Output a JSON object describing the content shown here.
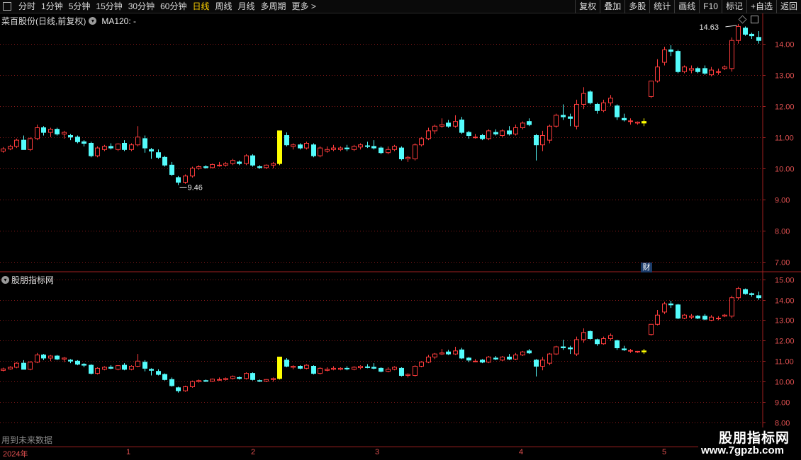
{
  "toolbar": {
    "periods": [
      "分时",
      "1分钟",
      "5分钟",
      "15分钟",
      "30分钟",
      "60分钟",
      "日线",
      "周线",
      "月线",
      "多周期",
      "更多 >"
    ],
    "active_period": "日线",
    "right_buttons": [
      "复权",
      "叠加",
      "多股",
      "统计",
      "画线",
      "F10",
      "标记",
      "+自选",
      "返回"
    ]
  },
  "main_panel": {
    "title": "菜百股份(日线,前复权)",
    "ma_label": "MA120: -",
    "high_label": "14.63",
    "low_label": "9.46",
    "badge": "财",
    "y_ticks": [
      "14.00",
      "13.00",
      "12.00",
      "11.00",
      "10.00",
      "9.00",
      "8.00",
      "7.00"
    ]
  },
  "sub_panel": {
    "title": "股朋指标网",
    "y_ticks": [
      "15.00",
      "14.00",
      "13.00",
      "12.00",
      "11.00",
      "10.00",
      "9.00",
      "8.00"
    ]
  },
  "footnote": "用到未来数据",
  "timeline": {
    "labels": [
      "2024年",
      "1",
      "2",
      "3",
      "4",
      "5"
    ]
  },
  "watermark": {
    "name": "股朋指标网",
    "url": "www.7gpzb.com"
  },
  "colors": {
    "up": "#ff3c3c",
    "down": "#54fcfc",
    "signal": "#ffff00",
    "grid": "#8a1a1a",
    "axis_text": "#e05050"
  },
  "chart_data": {
    "type": "candlestick",
    "ohlc": [
      [
        10.55,
        10.68,
        10.5,
        10.62
      ],
      [
        10.62,
        10.75,
        10.58,
        10.7
      ],
      [
        10.7,
        10.95,
        10.65,
        10.9
      ],
      [
        10.9,
        11.05,
        10.85,
        10.6
      ],
      [
        10.6,
        11.0,
        10.55,
        10.95
      ],
      [
        10.95,
        11.4,
        10.9,
        11.3
      ],
      [
        11.3,
        11.35,
        11.05,
        11.15
      ],
      [
        11.15,
        11.3,
        11.0,
        11.25
      ],
      [
        11.25,
        11.3,
        11.05,
        11.1
      ],
      [
        11.1,
        11.2,
        10.95,
        11.15
      ],
      [
        11.05,
        11.1,
        10.9,
        11.0
      ],
      [
        11.0,
        11.05,
        10.8,
        10.85
      ],
      [
        10.85,
        10.9,
        10.7,
        10.8
      ],
      [
        10.8,
        10.85,
        10.35,
        10.4
      ],
      [
        10.4,
        10.7,
        10.35,
        10.65
      ],
      [
        10.6,
        10.75,
        10.55,
        10.7
      ],
      [
        10.7,
        10.8,
        10.6,
        10.65
      ],
      [
        10.6,
        10.8,
        10.55,
        10.78
      ],
      [
        10.8,
        10.9,
        10.55,
        10.6
      ],
      [
        10.6,
        10.8,
        10.55,
        10.75
      ],
      [
        10.75,
        11.35,
        10.7,
        11.0
      ],
      [
        10.95,
        11.05,
        10.5,
        10.65
      ],
      [
        10.6,
        10.65,
        10.3,
        10.55
      ],
      [
        10.5,
        10.6,
        10.3,
        10.35
      ],
      [
        10.35,
        10.4,
        10.05,
        10.1
      ],
      [
        10.1,
        10.2,
        9.75,
        9.8
      ],
      [
        9.7,
        9.75,
        9.46,
        9.55
      ],
      [
        9.55,
        9.8,
        9.5,
        9.75
      ],
      [
        9.75,
        10.05,
        9.7,
        10.0
      ],
      [
        10.0,
        10.1,
        9.95,
        10.05
      ],
      [
        10.05,
        10.1,
        9.98,
        10.02
      ],
      [
        10.02,
        10.15,
        10.0,
        10.12
      ],
      [
        10.1,
        10.2,
        10.05,
        10.1
      ],
      [
        10.1,
        10.2,
        10.05,
        10.15
      ],
      [
        10.15,
        10.3,
        10.1,
        10.25
      ],
      [
        10.2,
        10.25,
        10.1,
        10.15
      ],
      [
        10.15,
        10.45,
        10.1,
        10.4
      ],
      [
        10.4,
        10.45,
        10.05,
        10.1
      ],
      [
        10.05,
        10.1,
        9.98,
        10.02
      ],
      [
        10.02,
        10.12,
        9.98,
        10.1
      ],
      [
        10.1,
        10.2,
        10.0,
        10.15
      ],
      [
        10.15,
        11.2,
        10.1,
        11.2
      ],
      [
        11.05,
        11.15,
        10.7,
        10.75
      ],
      [
        10.7,
        10.8,
        10.6,
        10.75
      ],
      [
        10.75,
        10.8,
        10.6,
        10.65
      ],
      [
        10.65,
        10.85,
        10.6,
        10.8
      ],
      [
        10.75,
        10.8,
        10.35,
        10.4
      ],
      [
        10.4,
        10.7,
        10.35,
        10.65
      ],
      [
        10.55,
        10.7,
        10.5,
        10.6
      ],
      [
        10.6,
        10.75,
        10.55,
        10.65
      ],
      [
        10.6,
        10.7,
        10.55,
        10.65
      ],
      [
        10.65,
        10.75,
        10.55,
        10.62
      ],
      [
        10.6,
        10.75,
        10.55,
        10.7
      ],
      [
        10.68,
        10.8,
        10.6,
        10.75
      ],
      [
        10.72,
        10.85,
        10.65,
        10.7
      ],
      [
        10.7,
        10.9,
        10.6,
        10.65
      ],
      [
        10.65,
        10.7,
        10.45,
        10.5
      ],
      [
        10.5,
        10.7,
        10.45,
        10.6
      ],
      [
        10.6,
        10.75,
        10.55,
        10.7
      ],
      [
        10.65,
        10.7,
        10.25,
        10.3
      ],
      [
        10.3,
        10.4,
        10.2,
        10.35
      ],
      [
        10.3,
        10.8,
        10.25,
        10.75
      ],
      [
        10.75,
        11.0,
        10.7,
        10.95
      ],
      [
        10.95,
        11.3,
        10.9,
        11.2
      ],
      [
        11.2,
        11.4,
        11.1,
        11.35
      ],
      [
        11.35,
        11.6,
        11.3,
        11.4
      ],
      [
        11.45,
        11.55,
        11.3,
        11.35
      ],
      [
        11.35,
        11.7,
        11.3,
        11.5
      ],
      [
        11.55,
        11.65,
        11.1,
        11.15
      ],
      [
        11.15,
        11.2,
        10.95,
        11.05
      ],
      [
        11.0,
        11.1,
        10.95,
        11.0
      ],
      [
        11.05,
        11.1,
        10.9,
        10.95
      ],
      [
        10.95,
        11.25,
        10.9,
        11.2
      ],
      [
        11.15,
        11.25,
        11.05,
        11.1
      ],
      [
        11.05,
        11.25,
        11.0,
        11.2
      ],
      [
        11.2,
        11.35,
        11.05,
        11.1
      ],
      [
        11.1,
        11.4,
        11.05,
        11.3
      ],
      [
        11.3,
        11.5,
        11.25,
        11.45
      ],
      [
        11.5,
        11.6,
        11.35,
        11.4
      ],
      [
        11.05,
        11.1,
        10.25,
        10.75
      ],
      [
        10.75,
        11.2,
        10.55,
        11.05
      ],
      [
        10.9,
        11.4,
        10.8,
        11.35
      ],
      [
        11.35,
        11.75,
        11.3,
        11.7
      ],
      [
        11.7,
        12.05,
        11.55,
        11.65
      ],
      [
        11.65,
        11.75,
        11.35,
        11.6
      ],
      [
        11.35,
        12.2,
        11.25,
        12.05
      ],
      [
        12.05,
        12.6,
        11.9,
        12.4
      ],
      [
        12.45,
        12.5,
        12.05,
        12.1
      ],
      [
        12.05,
        12.1,
        11.75,
        11.85
      ],
      [
        11.85,
        12.2,
        11.8,
        12.1
      ],
      [
        12.1,
        12.35,
        12.0,
        12.25
      ],
      [
        12.0,
        12.05,
        11.55,
        11.65
      ],
      [
        11.6,
        11.75,
        11.5,
        11.55
      ],
      [
        11.5,
        11.6,
        11.4,
        11.52
      ],
      [
        11.45,
        11.5,
        11.4,
        11.48
      ],
      [
        11.5,
        11.6,
        11.35,
        11.45
      ],
      [
        12.3,
        12.8,
        12.25,
        12.8
      ],
      [
        12.8,
        13.5,
        12.75,
        13.25
      ],
      [
        13.4,
        13.9,
        13.3,
        13.8
      ],
      [
        13.8,
        13.95,
        13.6,
        13.75
      ],
      [
        13.75,
        13.8,
        13.05,
        13.1
      ],
      [
        13.1,
        13.3,
        13.05,
        13.25
      ],
      [
        13.15,
        13.3,
        13.05,
        13.2
      ],
      [
        13.2,
        13.25,
        13.05,
        13.1
      ],
      [
        13.2,
        13.3,
        13.0,
        13.05
      ],
      [
        13.0,
        13.25,
        12.95,
        13.15
      ],
      [
        13.1,
        13.2,
        13.0,
        13.1
      ],
      [
        13.2,
        13.3,
        13.15,
        13.25
      ],
      [
        13.2,
        14.2,
        13.1,
        14.1
      ],
      [
        14.1,
        14.63,
        14.0,
        14.55
      ],
      [
        14.5,
        14.55,
        14.25,
        14.3
      ],
      [
        14.3,
        14.35,
        14.15,
        14.25
      ],
      [
        14.2,
        14.4,
        14.0,
        14.1
      ]
    ],
    "signal_index": [
      41,
      95
    ],
    "main_y_range": [
      6.7,
      14.9
    ],
    "main_y_ticks": [
      14,
      13,
      12,
      11,
      10,
      9,
      8,
      7
    ],
    "sub_y_range": [
      8.0,
      15.3
    ],
    "sub_y_ticks": [
      15,
      14,
      13,
      12,
      11,
      10,
      9,
      8
    ],
    "high": 14.63,
    "low": 9.46
  }
}
